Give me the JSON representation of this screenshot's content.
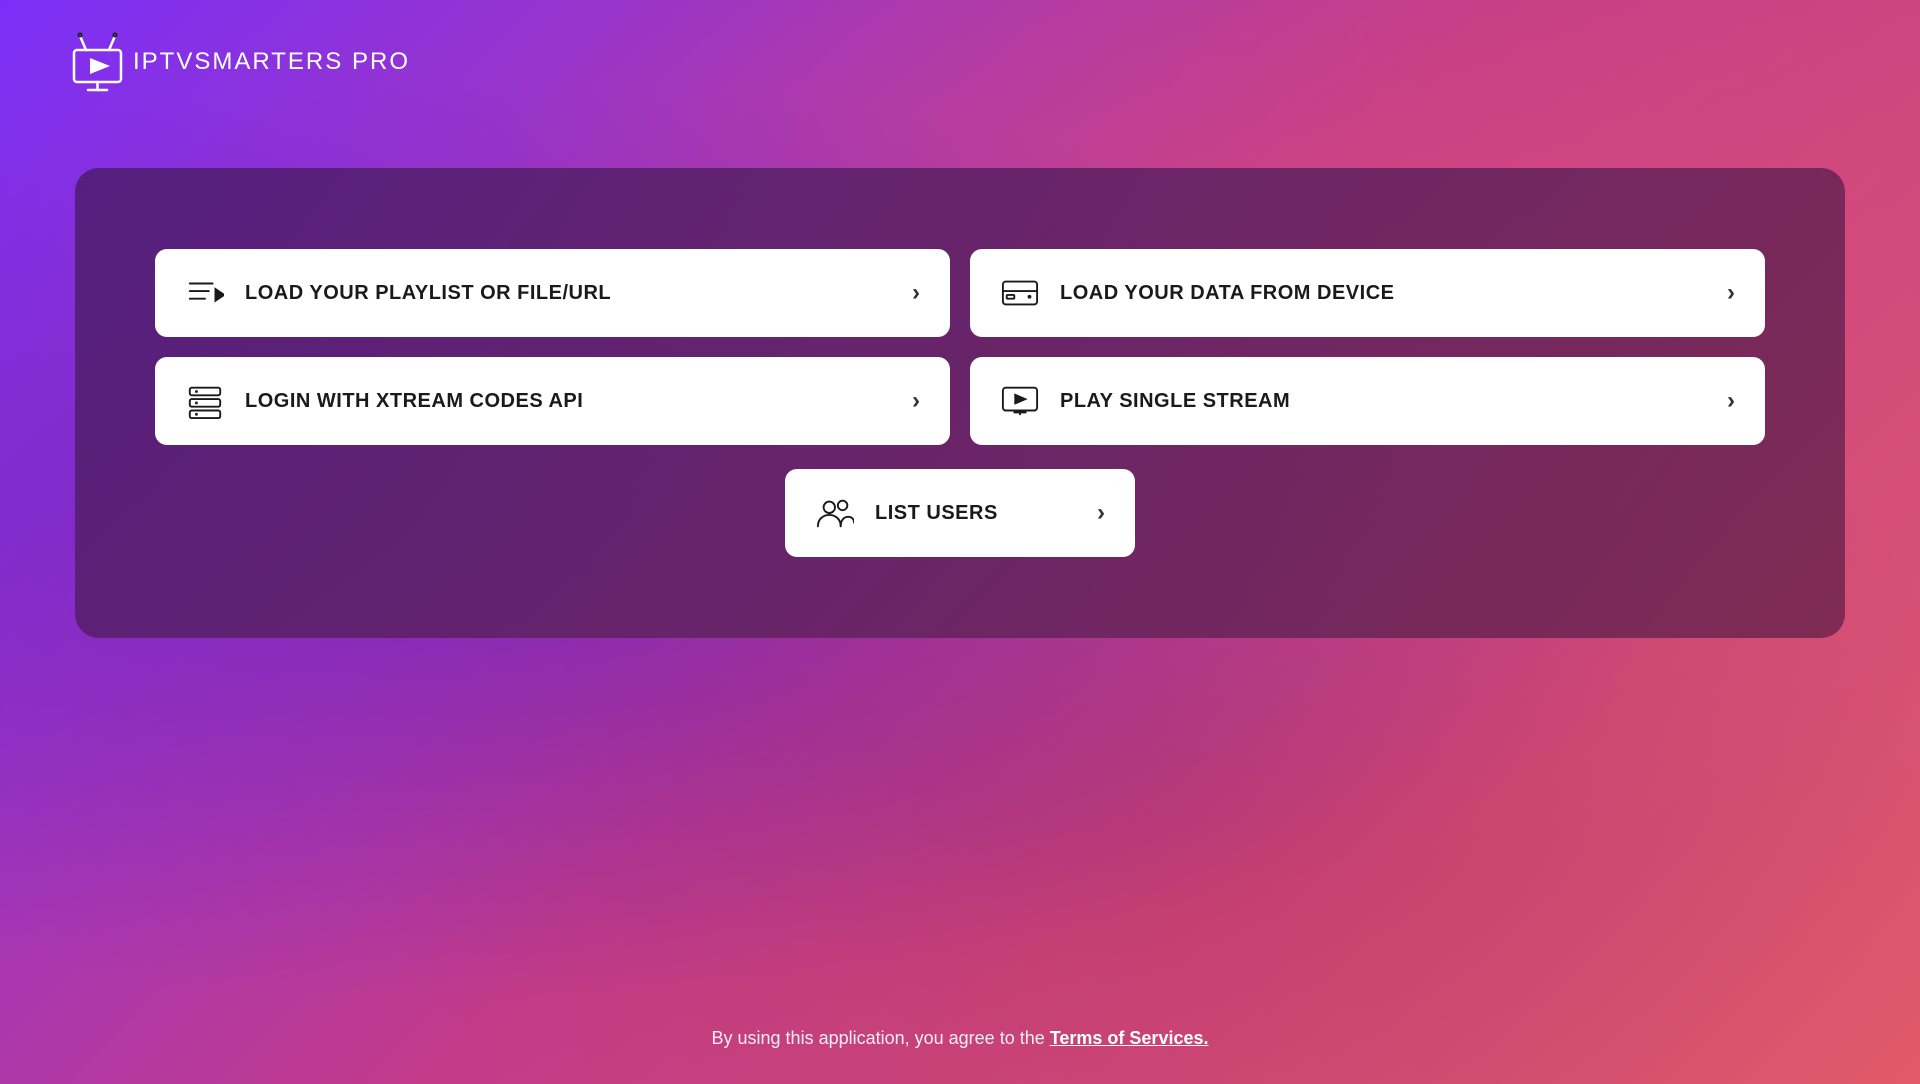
{
  "app": {
    "name": "IPTV",
    "brand": "SMARTERS",
    "edition": "PRO"
  },
  "panel": {
    "options": [
      {
        "id": "load-playlist",
        "label": "LOAD YOUR PLAYLIST OR FILE/URL",
        "icon": "playlist-icon"
      },
      {
        "id": "load-device",
        "label": "LOAD YOUR DATA FROM DEVICE",
        "icon": "device-icon"
      },
      {
        "id": "login-xtream",
        "label": "LOGIN WITH XTREAM CODES API",
        "icon": "xtream-icon"
      },
      {
        "id": "play-stream",
        "label": "PLAY SINGLE STREAM",
        "icon": "stream-icon"
      }
    ],
    "list_users": {
      "label": "LIST USERS",
      "icon": "users-icon"
    }
  },
  "footer": {
    "text": "By using this application, you agree to the ",
    "link": "Terms of Services."
  },
  "colors": {
    "background_start": "#7b2ff7",
    "background_end": "#e05a6a",
    "panel_bg": "rgba(80,30,120,0.92)",
    "card_bg": "#ffffff",
    "text_dark": "#1a1a1a"
  }
}
